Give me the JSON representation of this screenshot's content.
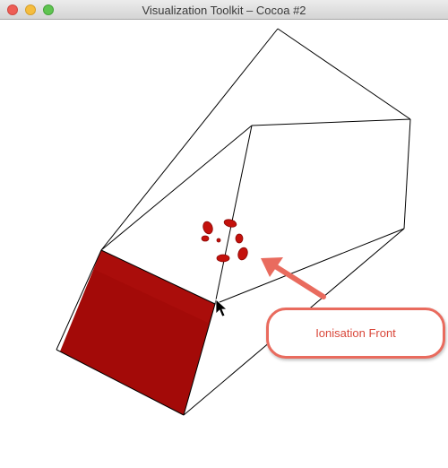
{
  "window": {
    "title": "Visualization Toolkit – Cocoa #2"
  },
  "annotation": {
    "label": "Ionisation Front"
  },
  "colors": {
    "slab": "#a30a08",
    "blob": "#c4110c",
    "arrow": "#e96b5e",
    "annotation_text": "#d9473a"
  },
  "icons": {
    "cursor": "arrow-cursor-icon"
  }
}
